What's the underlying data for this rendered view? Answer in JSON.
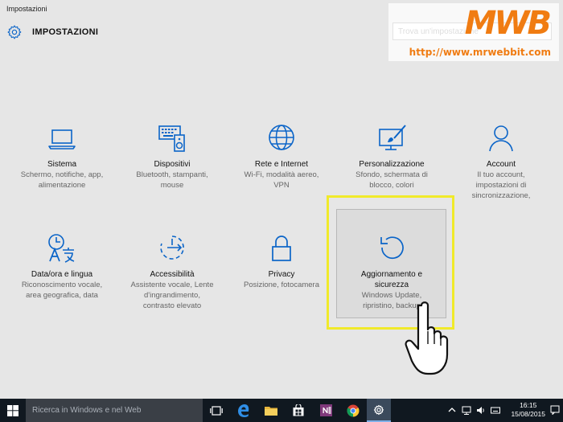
{
  "window": {
    "title": "Impostazioni"
  },
  "header": {
    "title": "IMPOSTAZIONI",
    "icon": "gear-icon"
  },
  "search": {
    "placeholder": "Trova un'impostazione"
  },
  "watermark": {
    "logo": "MWB",
    "url": "http://www.mrwebbit.com"
  },
  "tiles": [
    {
      "id": "sistema",
      "icon": "laptop-icon",
      "title": "Sistema",
      "desc": [
        "Schermo, notifiche, app,",
        "alimentazione"
      ]
    },
    {
      "id": "dispositivi",
      "icon": "devices-icon",
      "title": "Dispositivi",
      "desc": [
        "Bluetooth, stampanti,",
        "mouse"
      ]
    },
    {
      "id": "rete",
      "icon": "globe-icon",
      "title": "Rete e Internet",
      "desc": [
        "Wi-Fi, modalità aereo,",
        "VPN"
      ]
    },
    {
      "id": "personalizzazione",
      "icon": "paintbrush-icon",
      "title": "Personalizzazione",
      "desc": [
        "Sfondo, schermata di",
        "blocco, colori"
      ]
    },
    {
      "id": "account",
      "icon": "person-icon",
      "title": "Account",
      "desc": [
        "Il tuo account,",
        "impostazioni di",
        "sincronizzazione,"
      ]
    },
    {
      "id": "data-ora",
      "icon": "clock-language-icon",
      "title": "Data/ora e lingua",
      "desc": [
        "Riconoscimento vocale,",
        "area geografica, data"
      ]
    },
    {
      "id": "accessibilita",
      "icon": "accessibility-icon",
      "title": "Accessibilità",
      "desc": [
        "Assistente vocale, Lente",
        "d'ingrandimento,",
        "contrasto elevato"
      ]
    },
    {
      "id": "privacy",
      "icon": "lock-icon",
      "title": "Privacy",
      "desc": [
        "Posizione, fotocamera"
      ]
    },
    {
      "id": "aggiornamento",
      "icon": "refresh-icon",
      "title": "Aggiornamento e sicurezza",
      "desc": [
        "Windows Update,",
        "ripristino, backup"
      ]
    }
  ],
  "taskbar": {
    "search_text": "Ricerca in Windows e nel Web",
    "time": "16:15",
    "date": "15/08/2015"
  },
  "colors": {
    "accent": "#0a64c8",
    "highlight": "#f0ea2a",
    "brand": "#f07c12",
    "taskbar": "#101820"
  }
}
